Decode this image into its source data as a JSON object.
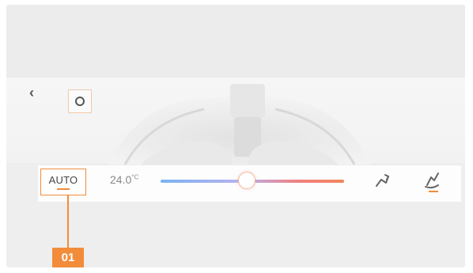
{
  "climate": {
    "back_icon": "chevron-left-icon",
    "power_icon": "power-icon",
    "auto_label": "AUTO",
    "temperature": "24.0",
    "temperature_unit": "°C",
    "temperature_slider_level": 0.47,
    "fan_mode_icon": "airflow-icon",
    "seat_mode_icon": "seat-airflow-icon",
    "seat_mode_active_color": "#f28c3a"
  },
  "callout": {
    "label": "01"
  },
  "colors": {
    "accent": "#f28c3a",
    "slider_cold": "#7ab3f2",
    "slider_hot": "#f2855a"
  }
}
